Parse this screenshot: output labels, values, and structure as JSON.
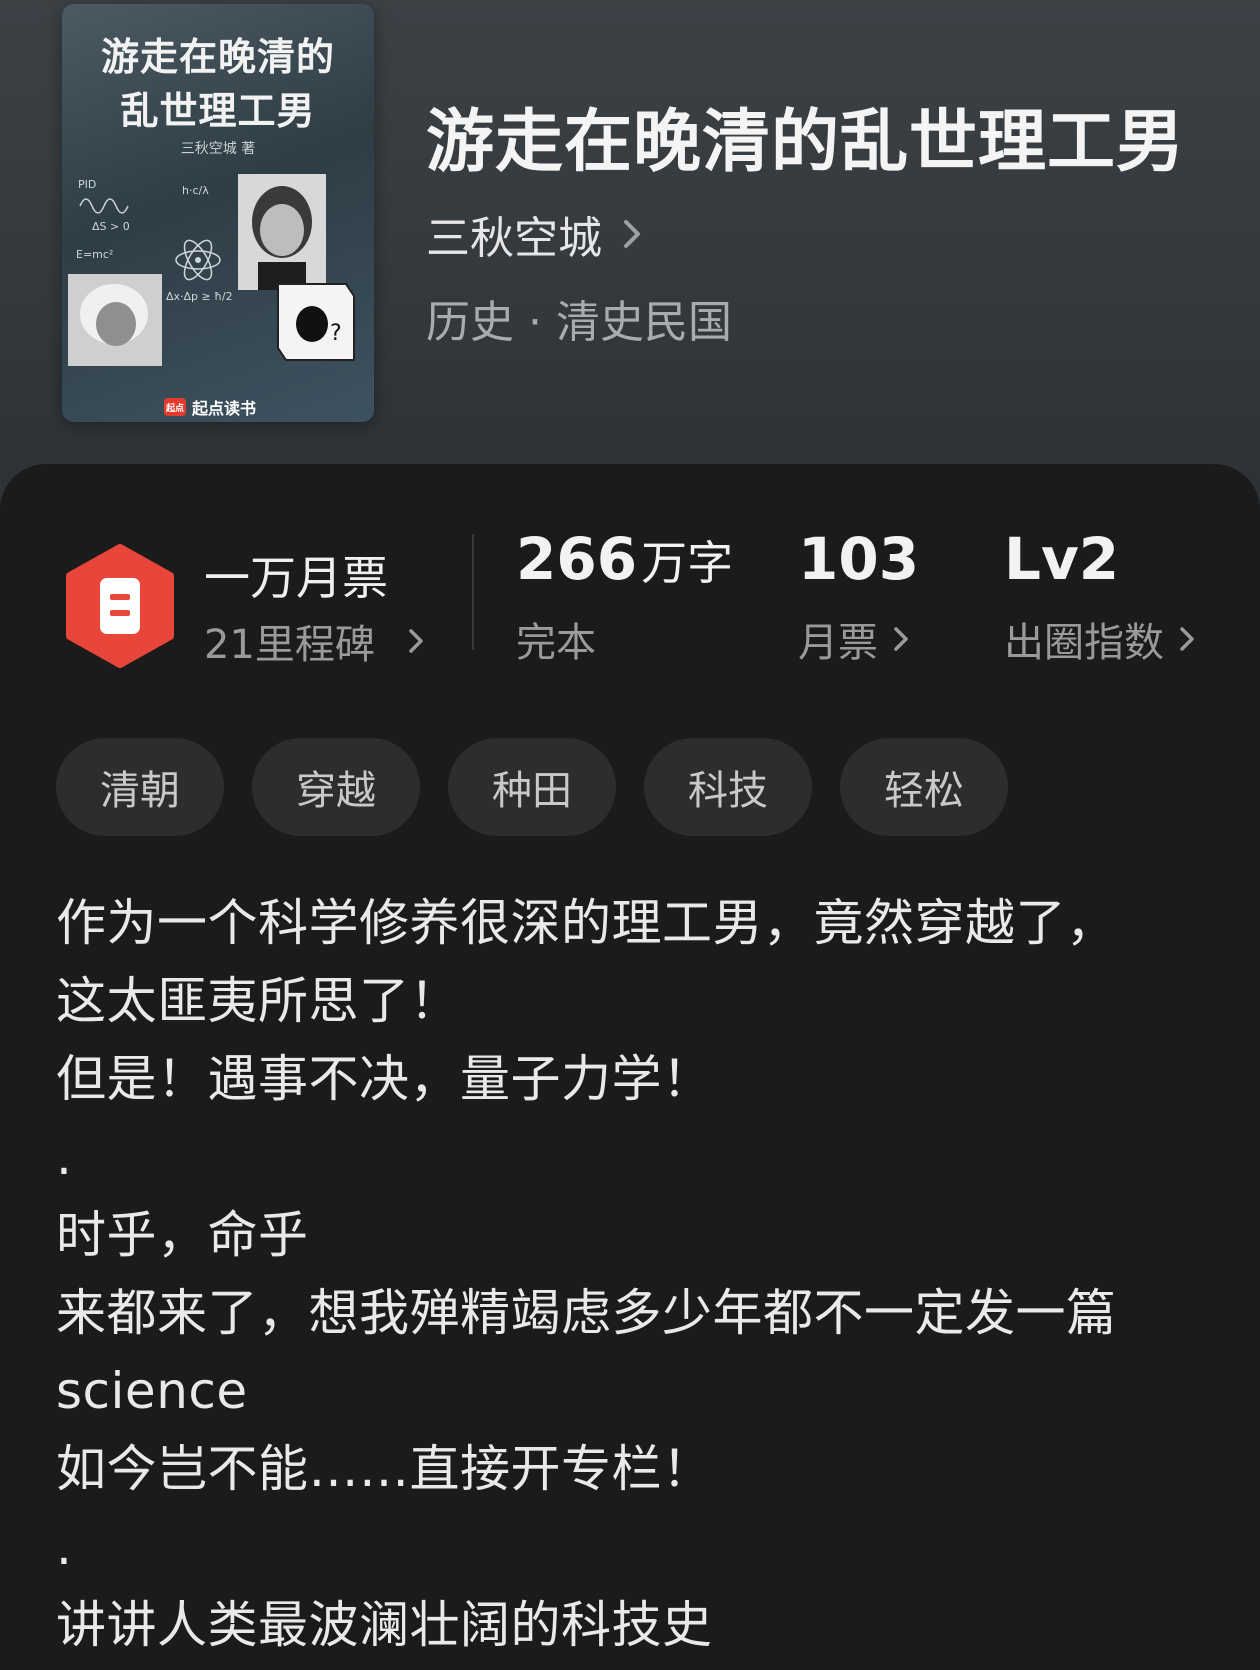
{
  "book": {
    "cover": {
      "title": "游走在晚清的\n乱世理工男",
      "author": "三秋空城 著",
      "publisher": "起点读书",
      "publisher_logo": "起点",
      "art_formulas": [
        "E=mc²",
        "h·c/λ",
        "Δx·Δp ≥ ħ/2",
        "PID",
        "ΔS > 0"
      ]
    },
    "title": "游走在晚清的乱世理工男",
    "author": "三秋空城",
    "genre": "历史 · 清史民国"
  },
  "stats": {
    "monthly_ticket_title": "一万月票",
    "milestones_label": "21里程碑",
    "word_count": "266",
    "word_unit": "万字",
    "status": "完本",
    "monthly_tickets": "103",
    "monthly_tickets_label": "月票",
    "popularity_level": "Lv2",
    "popularity_label": "出圈指数"
  },
  "tags": [
    "清朝",
    "穿越",
    "种田",
    "科技",
    "轻松"
  ],
  "synopsis": [
    "作为一个科学修养很深的理工男，竟然穿越了，",
    "这太匪夷所思了！",
    "但是！遇事不决，量子力学！",
    ".",
    "时乎，命乎",
    "来都来了，想我殚精竭虑多少年都不一定发一篇",
    "science",
    "如今岂不能……直接开专栏！",
    ".",
    "讲讲人类最波澜壮阔的科技史"
  ],
  "colors": {
    "accent_red": "#e8463b",
    "header_bg": "#3a3f44",
    "panel_bg": "#1b1b1c",
    "tag_bg": "#2d2d2e"
  },
  "icons": {
    "author_chevron": "chevron-right-icon",
    "ticket": "ticket-hexagon-icon"
  }
}
